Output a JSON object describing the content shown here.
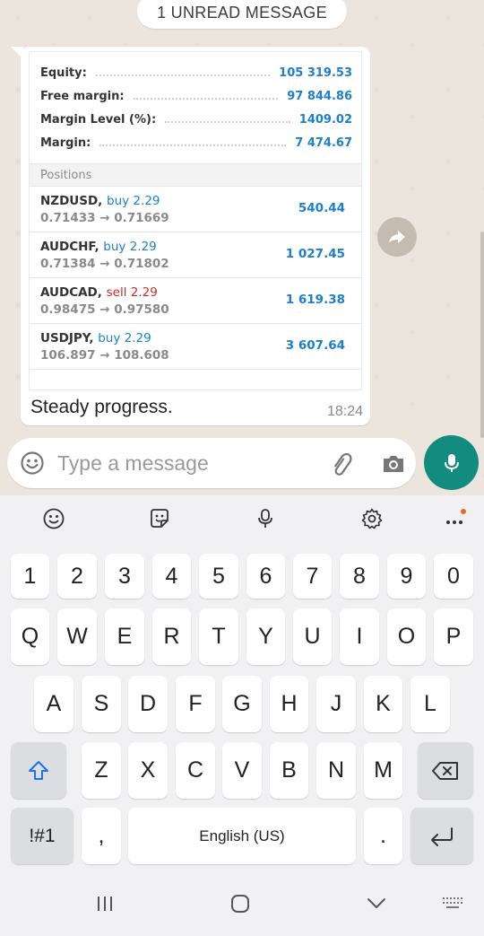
{
  "chat": {
    "unread_banner": "1 UNREAD MESSAGE",
    "account": [
      {
        "label": "Equity:",
        "value": "105 319.53"
      },
      {
        "label": "Free margin:",
        "value": "97 844.86"
      },
      {
        "label": "Margin Level (%):",
        "value": "1409.02"
      },
      {
        "label": "Margin:",
        "value": "7 474.67"
      }
    ],
    "positions_header": "Positions",
    "positions": [
      {
        "symbol": "NZDUSD,",
        "side": "buy 2.29",
        "side_type": "buy",
        "prices": "0.71433 → 0.71669",
        "profit": "540.44"
      },
      {
        "symbol": "AUDCHF,",
        "side": "buy 2.29",
        "side_type": "buy",
        "prices": "0.71384 → 0.71802",
        "profit": "1 027.45"
      },
      {
        "symbol": "AUDCAD,",
        "side": "sell 2.29",
        "side_type": "sell",
        "prices": "0.98475 → 0.97580",
        "profit": "1 619.38"
      },
      {
        "symbol": "USDJPY,",
        "side": "buy 2.29",
        "side_type": "buy",
        "prices": "106.897 → 108.608",
        "profit": "3 607.64"
      }
    ],
    "caption": "Steady progress.",
    "time": "18:24"
  },
  "composer": {
    "placeholder": "Type a message",
    "icons": [
      "emoji-icon",
      "paperclip-icon",
      "camera-icon",
      "microphone-icon"
    ]
  },
  "keyboard": {
    "toolbar": [
      "emoji-icon",
      "sticker-icon",
      "voice-input-icon",
      "settings-icon",
      "more-icon"
    ],
    "row_numbers": [
      "1",
      "2",
      "3",
      "4",
      "5",
      "6",
      "7",
      "8",
      "9",
      "0"
    ],
    "row_1": [
      "Q",
      "W",
      "E",
      "R",
      "T",
      "Y",
      "U",
      "I",
      "O",
      "P"
    ],
    "row_2": [
      "A",
      "S",
      "D",
      "F",
      "G",
      "H",
      "J",
      "K",
      "L"
    ],
    "row_3": [
      "Z",
      "X",
      "C",
      "V",
      "B",
      "N",
      "M"
    ],
    "symbols_key": "!#1",
    "comma_key": ",",
    "space_label": "English (US)",
    "period_key": "."
  },
  "colors": {
    "accent_green": "#128c7e",
    "profit_blue": "#1c7fd0",
    "sell_red": "#d12b2b"
  }
}
